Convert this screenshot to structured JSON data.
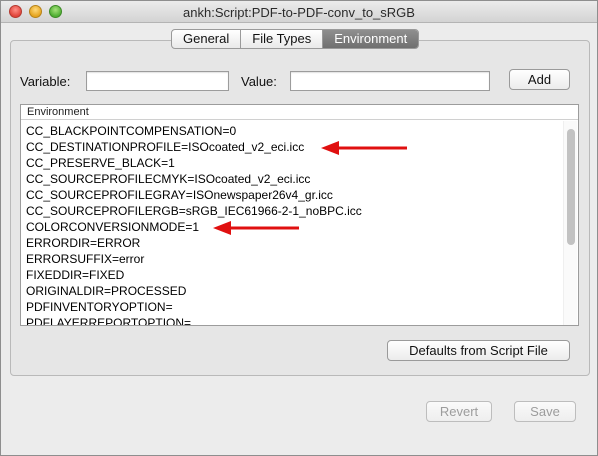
{
  "window": {
    "title": "ankh:Script:PDF-to-PDF-conv_to_sRGB"
  },
  "tabs": [
    {
      "label": "General"
    },
    {
      "label": "File Types"
    },
    {
      "label": "Environment",
      "selected": true
    }
  ],
  "form": {
    "variable_label": "Variable:",
    "variable_value": "",
    "value_label": "Value:",
    "value_value": "",
    "add_label": "Add"
  },
  "environment": {
    "header": "Environment",
    "rows": [
      "CC_BLACKPOINTCOMPENSATION=0",
      "CC_DESTINATIONPROFILE=ISOcoated_v2_eci.icc",
      "CC_PRESERVE_BLACK=1",
      "CC_SOURCEPROFILECMYK=ISOcoated_v2_eci.icc",
      "CC_SOURCEPROFILEGRAY=ISOnewspaper26v4_gr.icc",
      "CC_SOURCEPROFILERGB=sRGB_IEC61966-2-1_noBPC.icc",
      "COLORCONVERSIONMODE=1",
      "ERRORDIR=ERROR",
      "ERRORSUFFIX=error",
      "FIXEDDIR=FIXED",
      "ORIGINALDIR=PROCESSED",
      "PDFINVENTORYOPTION=",
      "PDFLAYERREPORTOPTION="
    ]
  },
  "buttons": {
    "defaults": "Defaults from Script File",
    "revert": "Revert",
    "save": "Save"
  },
  "colors": {
    "annotation_arrow": "#e01010",
    "selected_tab": "#7a7a7a"
  }
}
